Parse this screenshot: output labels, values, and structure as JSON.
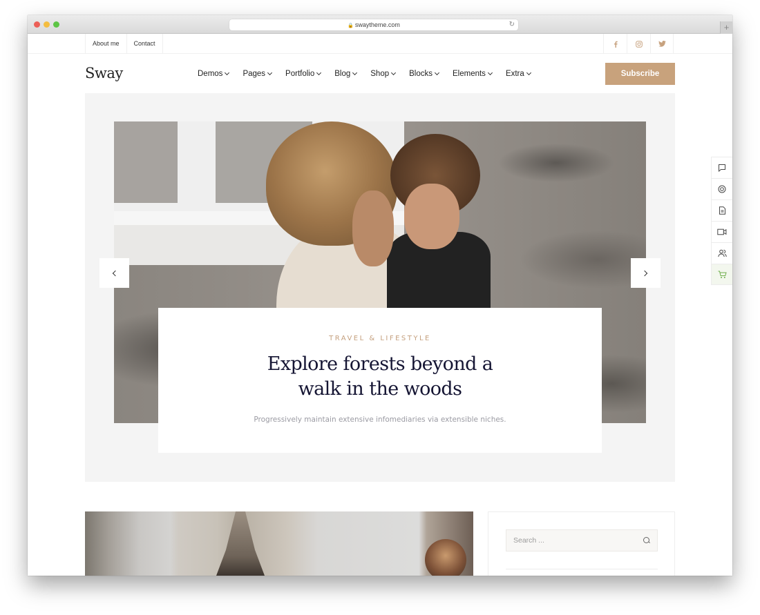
{
  "browser": {
    "url": "swaytheme.com",
    "lock_icon": "lock-icon",
    "reload_icon": "reload-icon",
    "new_tab_label": "+"
  },
  "topbar": {
    "links": [
      {
        "label": "About me"
      },
      {
        "label": "Contact"
      }
    ],
    "social": [
      {
        "name": "facebook-icon",
        "glyph": "f"
      },
      {
        "name": "instagram-icon",
        "glyph": "◎"
      },
      {
        "name": "twitter-icon",
        "glyph": "🐦"
      }
    ]
  },
  "header": {
    "logo": "Sway",
    "nav": [
      {
        "label": "Demos"
      },
      {
        "label": "Pages"
      },
      {
        "label": "Portfolio"
      },
      {
        "label": "Blog"
      },
      {
        "label": "Shop"
      },
      {
        "label": "Blocks"
      },
      {
        "label": "Elements"
      },
      {
        "label": "Extra"
      }
    ],
    "subscribe_label": "Subscribe"
  },
  "hero": {
    "kicker": "TRAVEL & LIFESTYLE",
    "title_line1": "Explore forests beyond a",
    "title_line2": "walk in the woods",
    "subtitle": "Progressively maintain extensive infomediaries via extensible niches."
  },
  "side_toolbar": [
    {
      "name": "chat-icon"
    },
    {
      "name": "support-icon"
    },
    {
      "name": "document-icon"
    },
    {
      "name": "video-icon"
    },
    {
      "name": "users-icon"
    },
    {
      "name": "cart-icon"
    }
  ],
  "sidebar": {
    "search_placeholder": "Search ..."
  },
  "colors": {
    "accent": "#c8a27c",
    "title": "#151533",
    "hero_bg": "#f4f4f4",
    "cart_active": "#6fae4c"
  }
}
